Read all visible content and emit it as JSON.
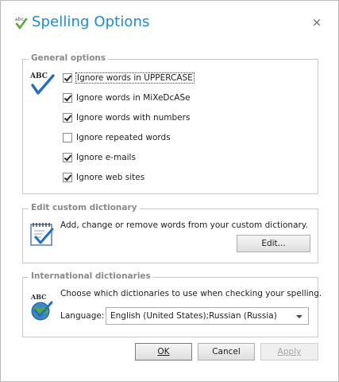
{
  "window": {
    "title": "Spelling Options",
    "close_glyph": "×"
  },
  "general": {
    "legend": "General options",
    "options": [
      {
        "label": "Ignore words in UPPERCASE",
        "checked": true
      },
      {
        "label": "Ignore words in MiXeDcASe",
        "checked": true
      },
      {
        "label": "Ignore words with numbers",
        "checked": true
      },
      {
        "label": "Ignore repeated words",
        "checked": false
      },
      {
        "label": "Ignore e-mails",
        "checked": true
      },
      {
        "label": "Ignore web sites",
        "checked": true
      }
    ]
  },
  "custom": {
    "legend": "Edit custom dictionary",
    "description": "Add, change or remove words from your custom dictionary.",
    "edit_label": "Edit..."
  },
  "international": {
    "legend": "International dictionaries",
    "description": "Choose which dictionaries to use when checking your spelling.",
    "language_label": "Language:",
    "language_value": "English (United States);Russian (Russia)"
  },
  "buttons": {
    "ok": "OK",
    "cancel": "Cancel",
    "apply": "Apply"
  },
  "colors": {
    "title": "#1c8ad6",
    "legend": "#8a8a8a",
    "check_blue": "#1f6fc7",
    "green": "#5aa83a"
  },
  "icons": {
    "app": "abc-check-icon",
    "abc_check": "abc-checkmark-icon",
    "notepad": "notepad-check-icon",
    "globe": "abc-globe-icon"
  }
}
